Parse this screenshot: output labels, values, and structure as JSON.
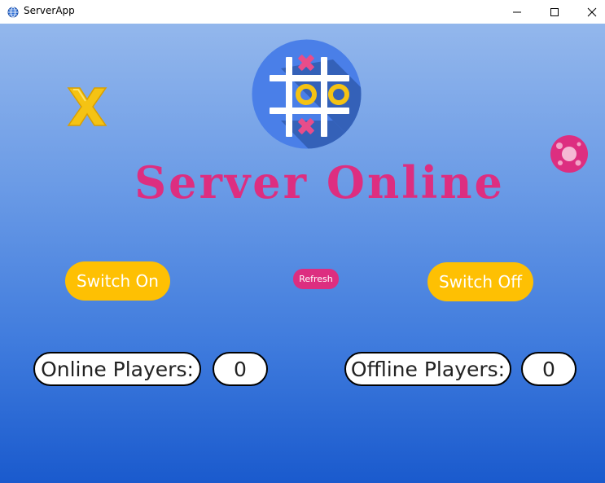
{
  "window": {
    "title": "ServerApp",
    "icon": "globe-icon",
    "controls": [
      "minimize-icon",
      "maximize-icon",
      "close-icon"
    ]
  },
  "main": {
    "status_title": "Server Online",
    "switch_on_label": "Switch On",
    "refresh_label": "Refresh",
    "switch_off_label": "Switch Off",
    "online_players_label": "Online Players:",
    "online_players_count": "0",
    "offline_players_label": "Offline Players:",
    "offline_players_count": "0"
  },
  "colors": {
    "accent_pink": "#dd2e80",
    "button_yellow": "#fec003",
    "gradient_top": "#93b7ec",
    "gradient_bottom": "#1a5acd"
  },
  "icons": {
    "logo": "tic-tac-toe-logo-icon",
    "x_decoration": "x-mark-icon",
    "o_decoration": "o-mark-icon"
  }
}
